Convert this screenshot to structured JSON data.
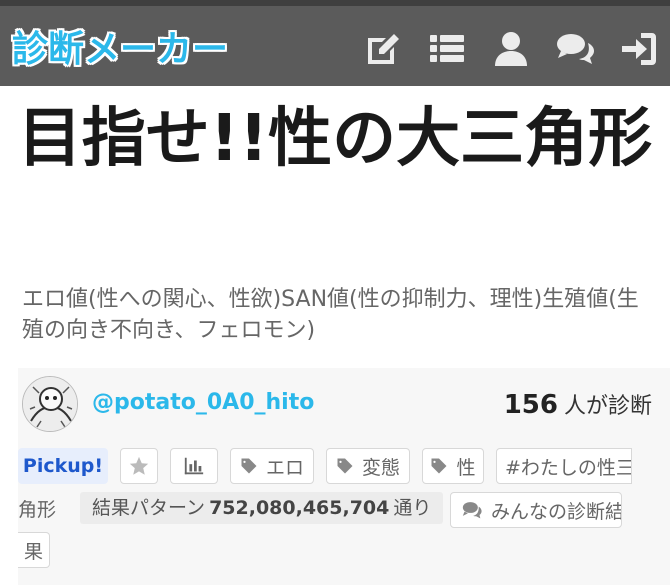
{
  "header": {
    "logo": "診断メーカー",
    "icons": [
      "edit-icon",
      "list-icon",
      "user-icon",
      "comments-icon",
      "sign-in-icon"
    ],
    "colors": {
      "bar": "#5b5b5b",
      "logo": "#2bb8ea"
    }
  },
  "shindan": {
    "title": "目指せ!!性の大三角形",
    "description": "エロ値(性への関心、性欲)SAN値(性の抑制力、理性)生殖値(生殖の向き不向き、フェロモン)"
  },
  "info": {
    "author": "@potato_0A0_hito",
    "count": "156",
    "count_suffix": "人が診断"
  },
  "tags": {
    "pickup": "Pickup!",
    "tag1": "エロ",
    "tag2": "変態",
    "tag3": "性",
    "hashtag_start": "#わたしの性三",
    "hashtag_end": "角形"
  },
  "patterns": {
    "label": "結果パターン",
    "value": "752,080,465,704",
    "suffix": "通り"
  },
  "share": {
    "label_start": "みんなの診断結",
    "label_end": "果"
  }
}
